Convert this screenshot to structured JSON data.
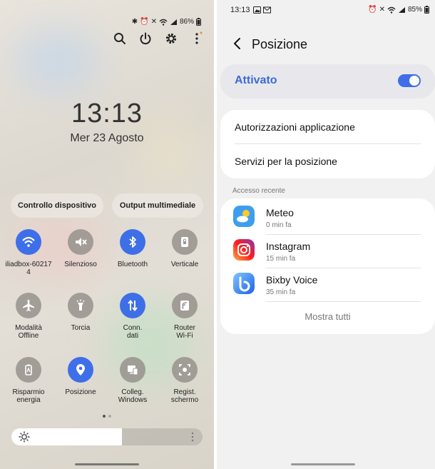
{
  "left": {
    "status": {
      "battery": "86%"
    },
    "clock": "13:13",
    "date": "Mer 23 Agosto",
    "pills": [
      "Controllo dispositivo",
      "Output multimediale"
    ],
    "tiles": [
      {
        "label": "iliadbox-60217\n4",
        "icon": "wifi-icon",
        "on": true
      },
      {
        "label": "Silenzioso",
        "icon": "mute-icon",
        "on": false
      },
      {
        "label": "Bluetooth",
        "icon": "bluetooth-icon",
        "on": true
      },
      {
        "label": "Verticale",
        "icon": "portrait-lock-icon",
        "on": false
      },
      {
        "label": "Modalità\nOffline",
        "icon": "airplane-icon",
        "on": false
      },
      {
        "label": "Torcia",
        "icon": "flashlight-icon",
        "on": false
      },
      {
        "label": "Conn.\ndati",
        "icon": "data-arrows-icon",
        "on": true
      },
      {
        "label": "Router\nWi-Fi",
        "icon": "hotspot-icon",
        "on": false
      },
      {
        "label": "Risparmio\nenergia",
        "icon": "battery-saver-icon",
        "on": false
      },
      {
        "label": "Posizione",
        "icon": "location-icon",
        "on": true
      },
      {
        "label": "Colleg.\nWindows",
        "icon": "link-windows-icon",
        "on": false
      },
      {
        "label": "Regist.\nschermo",
        "icon": "screen-record-icon",
        "on": false
      }
    ],
    "brightness": 0.58
  },
  "right": {
    "status": {
      "time": "13:13",
      "battery": "85%"
    },
    "title": "Posizione",
    "toggle": {
      "label": "Attivato",
      "on": true
    },
    "items": [
      "Autorizzazioni applicazione",
      "Servizi per la posizione"
    ],
    "section": "Accesso recente",
    "apps": [
      {
        "name": "Meteo",
        "time": "0 min fa"
      },
      {
        "name": "Instagram",
        "time": "15 min fa"
      },
      {
        "name": "Bixby Voice",
        "time": "35 min fa"
      }
    ],
    "show_all": "Mostra tutti"
  },
  "colors": {
    "accent": "#3e6fe8",
    "toggle_text": "#3b6bd6"
  }
}
